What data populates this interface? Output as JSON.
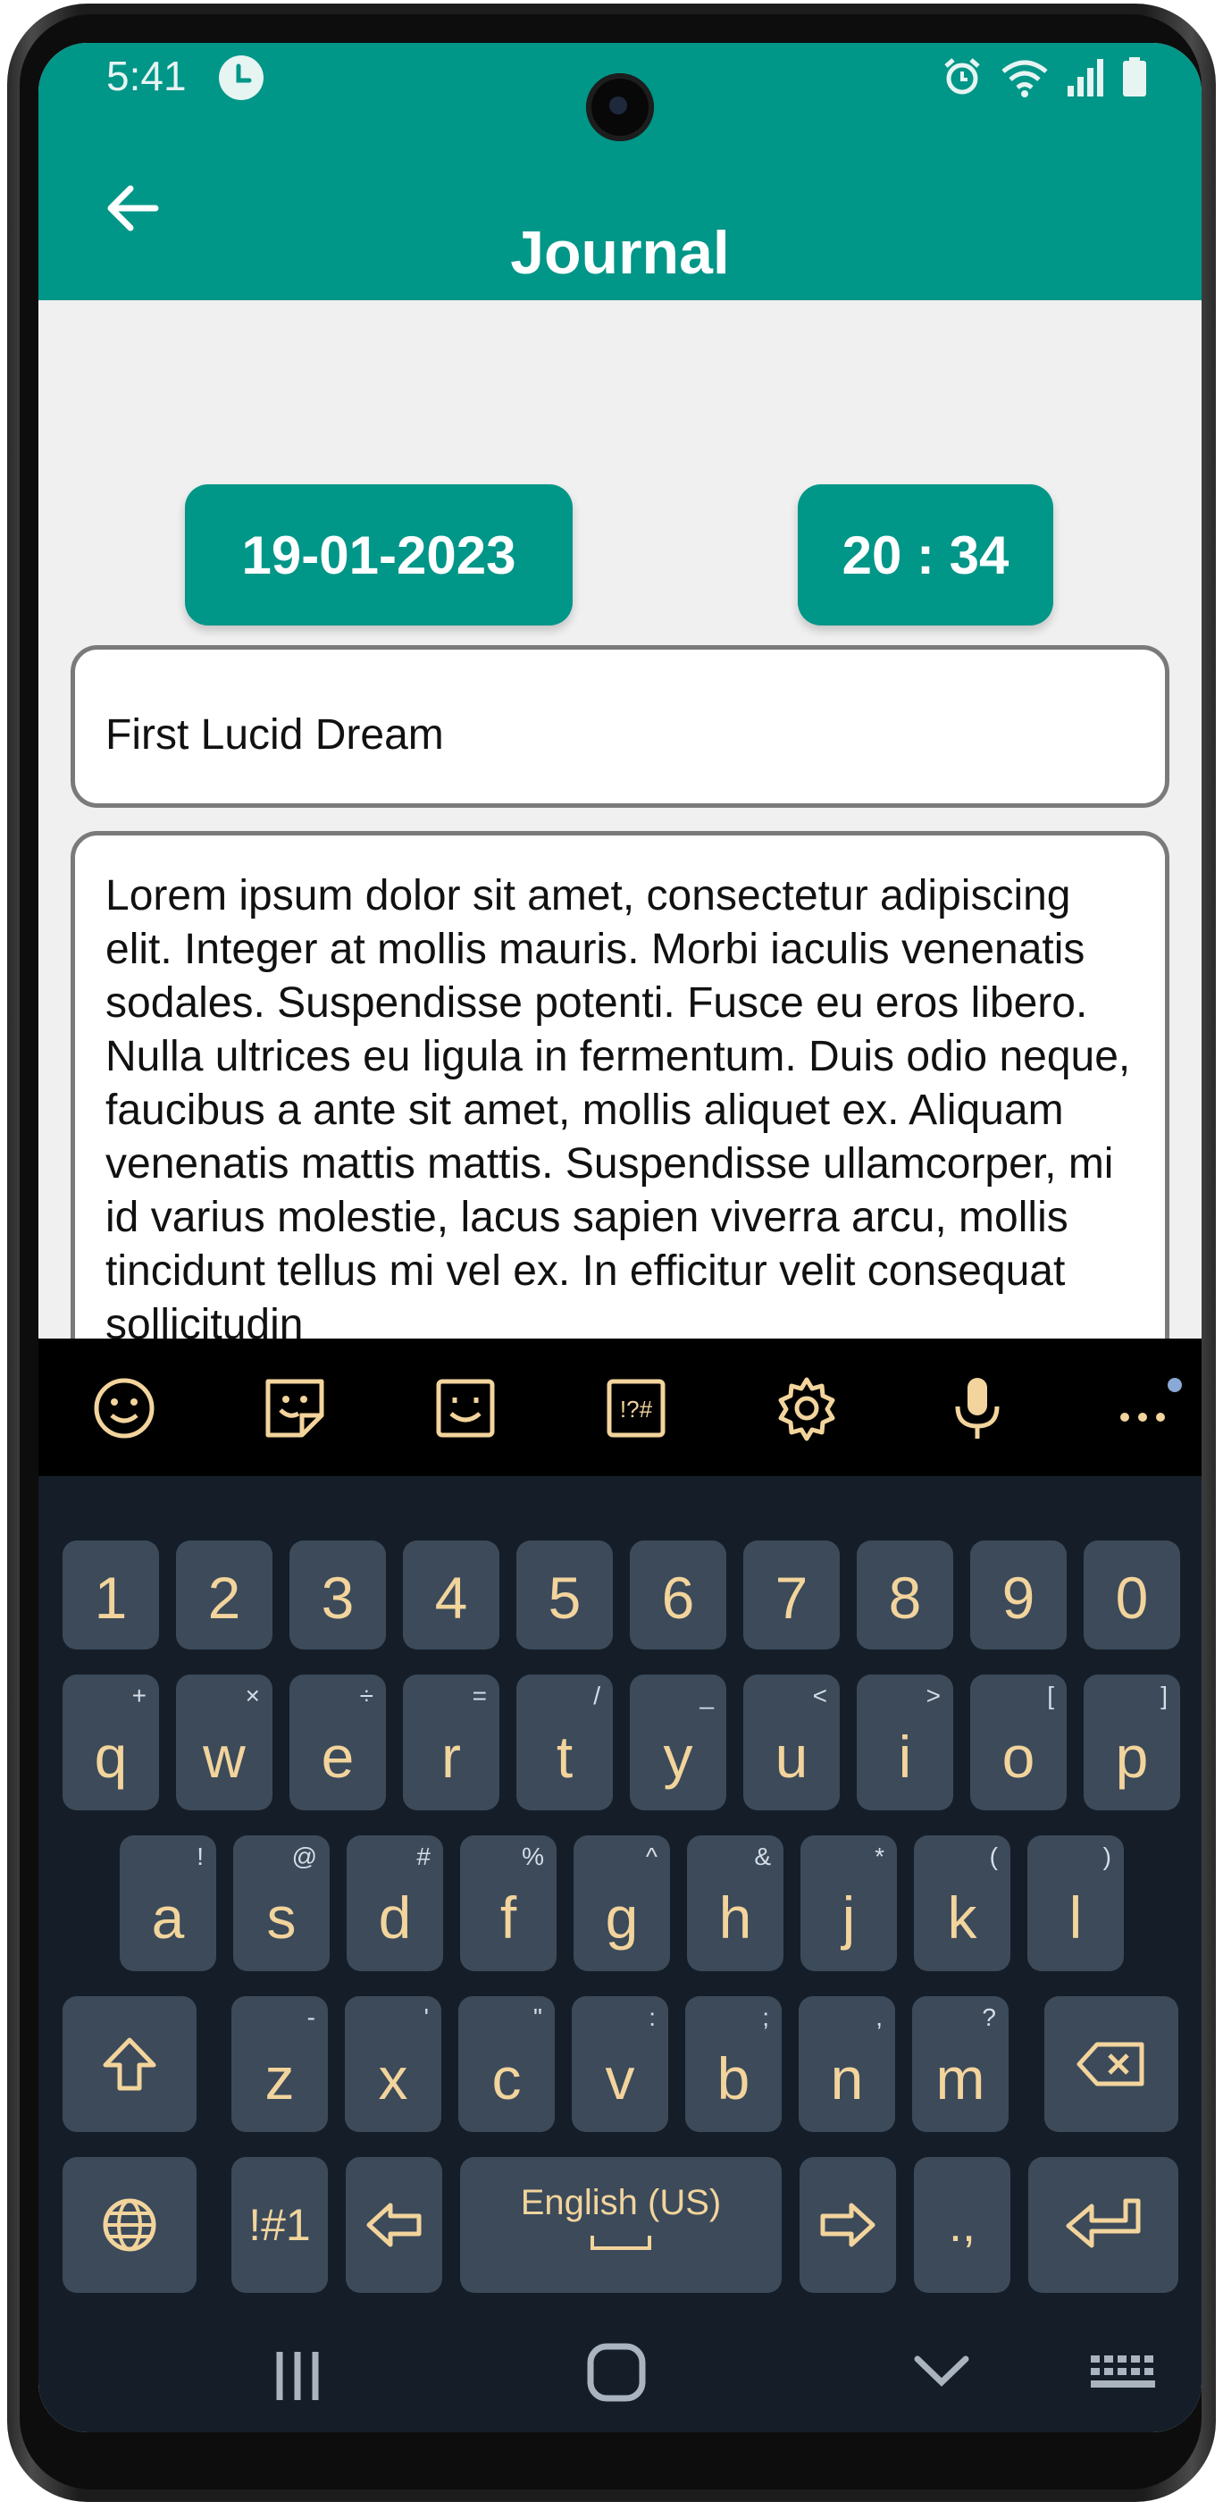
{
  "status_bar": {
    "time": "5:41"
  },
  "app_bar": {
    "title": "Journal"
  },
  "entry": {
    "date": "19-01-2023",
    "time": "20 : 34",
    "title_value": "First Lucid Dream",
    "body_value": "Lorem ipsum dolor sit amet, consectetur adipiscing elit. Integer at mollis mauris. Morbi iaculis venenatis sodales. Suspendisse potenti. Fusce eu eros libero. Nulla ultrices eu ligula in fermentum. Duis odio neque, faucibus a ante sit amet, mollis aliquet ex. Aliquam venenatis mattis mattis. Suspendisse ullamcorper, mi id varius molestie, lacus sapien viverra arcu, mollis tincidunt tellus mi vel ex. In efficitur velit consequat sollicitudin"
  },
  "keyboard": {
    "toolbar_icons": [
      "emoji-icon",
      "sticker-icon",
      "bitmoji-icon",
      "symbols-icon",
      "gear-icon",
      "microphone-icon",
      "more-icon"
    ],
    "number_row": [
      "1",
      "2",
      "3",
      "4",
      "5",
      "6",
      "7",
      "8",
      "9",
      "0"
    ],
    "row1": [
      {
        "key": "q",
        "sub": "+"
      },
      {
        "key": "w",
        "sub": "×"
      },
      {
        "key": "e",
        "sub": "÷"
      },
      {
        "key": "r",
        "sub": "="
      },
      {
        "key": "t",
        "sub": "/"
      },
      {
        "key": "y",
        "sub": "_"
      },
      {
        "key": "u",
        "sub": "<"
      },
      {
        "key": "i",
        "sub": ">"
      },
      {
        "key": "o",
        "sub": "["
      },
      {
        "key": "p",
        "sub": "]"
      }
    ],
    "row2": [
      {
        "key": "a",
        "sub": "!"
      },
      {
        "key": "s",
        "sub": "@"
      },
      {
        "key": "d",
        "sub": "#"
      },
      {
        "key": "f",
        "sub": "%"
      },
      {
        "key": "g",
        "sub": "^"
      },
      {
        "key": "h",
        "sub": "&"
      },
      {
        "key": "j",
        "sub": "*"
      },
      {
        "key": "k",
        "sub": "("
      },
      {
        "key": "l",
        "sub": ")"
      }
    ],
    "row3": [
      {
        "key": "z",
        "sub": "-"
      },
      {
        "key": "x",
        "sub": "'"
      },
      {
        "key": "c",
        "sub": "\""
      },
      {
        "key": "v",
        "sub": ":"
      },
      {
        "key": "b",
        "sub": ";"
      },
      {
        "key": "n",
        "sub": ","
      },
      {
        "key": "m",
        "sub": "?"
      }
    ],
    "symbols_key": "!#1",
    "space_label": "English (US)",
    "punct_key": ".,"
  }
}
